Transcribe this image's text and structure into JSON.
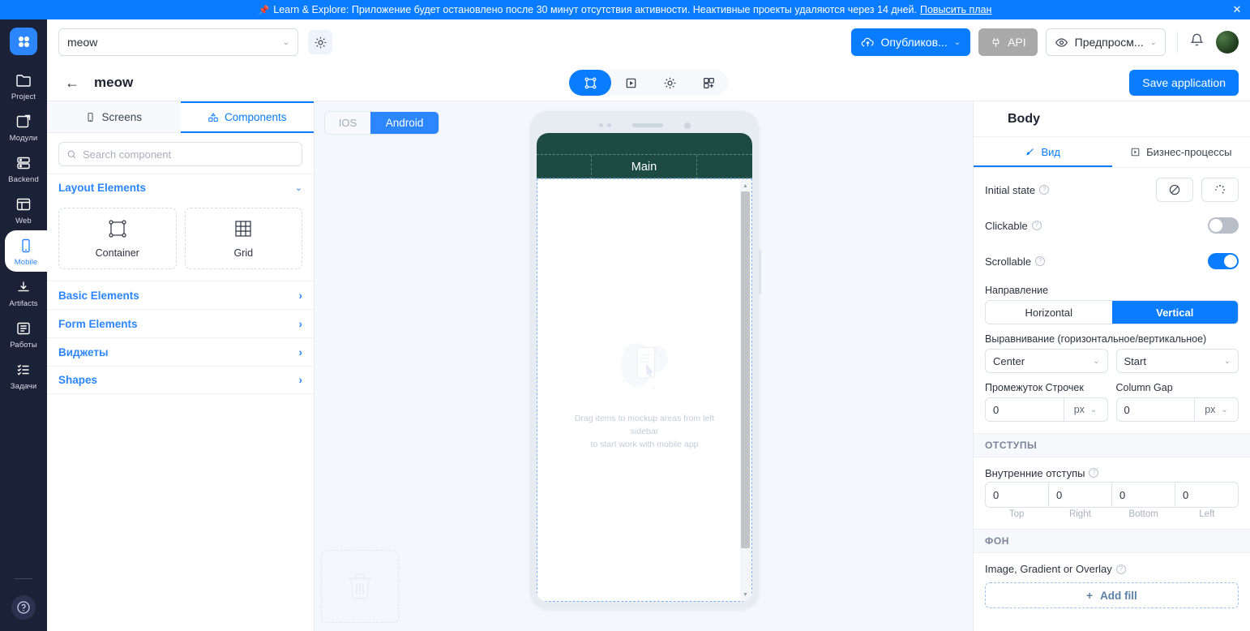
{
  "banner": {
    "icon": "pushpin-icon",
    "text": "Learn & Explore: Приложение будет остановлено после 30 минут отсутствия активности. Неактивные проекты удаляются через 14 дней.",
    "link": "Повысить план",
    "close": "✕"
  },
  "rail": {
    "logo": "grid-logo-icon",
    "items": [
      {
        "label": "Project",
        "icon": "folder-icon"
      },
      {
        "label": "Модули",
        "icon": "modules-icon"
      },
      {
        "label": "Backend",
        "icon": "server-icon"
      },
      {
        "label": "Web",
        "icon": "browser-icon"
      },
      {
        "label": "Mobile",
        "icon": "phone-icon"
      },
      {
        "label": "Artifacts",
        "icon": "download-icon"
      },
      {
        "label": "Работы",
        "icon": "list-icon"
      },
      {
        "label": "Задачи",
        "icon": "checklist-icon"
      }
    ],
    "active": "Mobile",
    "help": "?"
  },
  "header": {
    "project_name": "meow",
    "settings_icon": "gear-icon",
    "publish_label": "Опубликов...",
    "api_label": "API",
    "preview_label": "Предпросм...",
    "bell_icon": "bell-icon",
    "avatar": "user-avatar"
  },
  "subheader": {
    "back_icon": "back-arrow-icon",
    "title": "meow",
    "tools": [
      {
        "name": "design-tool",
        "icon": "frame-icon",
        "active": true
      },
      {
        "name": "preview-tool",
        "icon": "play-icon",
        "active": false
      },
      {
        "name": "settings-tool",
        "icon": "gear-icon",
        "active": false
      },
      {
        "name": "integrations-tool",
        "icon": "puzzle-icon",
        "active": false
      }
    ],
    "save_label": "Save application"
  },
  "left_panel": {
    "tabs": [
      {
        "label": "Screens",
        "icon": "phone-icon",
        "active": false
      },
      {
        "label": "Components",
        "icon": "components-icon",
        "active": true
      }
    ],
    "search_placeholder": "Search component",
    "search_value": "",
    "sections": [
      {
        "label": "Layout Elements",
        "expanded": true
      },
      {
        "label": "Basic Elements",
        "expanded": false
      },
      {
        "label": "Form Elements",
        "expanded": false
      },
      {
        "label": "Виджеты",
        "expanded": false
      },
      {
        "label": "Shapes",
        "expanded": false
      }
    ],
    "layout_components": [
      {
        "label": "Container",
        "icon": "container-icon"
      },
      {
        "label": "Grid",
        "icon": "grid-icon"
      }
    ]
  },
  "canvas": {
    "platforms": [
      {
        "label": "IOS",
        "active": false
      },
      {
        "label": "Android",
        "active": true
      }
    ],
    "phone": {
      "appbar_title": "Main",
      "appbar_color": "#1d4a42",
      "placeholder_line1": "Drag items to mockup areas from left sidebar",
      "placeholder_line2": "to start work with mobile app"
    },
    "trash_icon": "trash-icon"
  },
  "right_panel": {
    "title": "Body",
    "tabs": [
      {
        "label": "Вид",
        "icon": "brush-icon",
        "active": true
      },
      {
        "label": "Бизнес-процессы",
        "icon": "flow-icon",
        "active": false
      }
    ],
    "initial_state": {
      "label": "Initial state",
      "options": [
        {
          "name": "disabled-icon",
          "glyph": "⊘"
        },
        {
          "name": "loading-icon",
          "glyph": "◌"
        }
      ]
    },
    "clickable": {
      "label": "Clickable",
      "value": false
    },
    "scrollable": {
      "label": "Scrollable",
      "value": true
    },
    "direction": {
      "label": "Направление",
      "options": [
        "Horizontal",
        "Vertical"
      ],
      "selected": "Vertical"
    },
    "alignment": {
      "label": "Выравнивание (горизонтальное/вертикальное)",
      "horizontal": "Center",
      "vertical": "Start"
    },
    "row_gap": {
      "label": "Промежуток Строчек",
      "value": "0",
      "unit": "px"
    },
    "column_gap": {
      "label": "Column Gap",
      "value": "0",
      "unit": "px"
    },
    "paddings_group": "ОТСТУПЫ",
    "inner_paddings": {
      "label": "Внутренние отступы",
      "values": [
        "0",
        "0",
        "0",
        "0"
      ],
      "labels": [
        "Top",
        "Right",
        "Bottom",
        "Left"
      ]
    },
    "background_group": "ФОН",
    "fill": {
      "label": "Image, Gradient or Overlay",
      "add_label": "Add fill",
      "plus": "+"
    }
  },
  "colors": {
    "accent": "#0a7cff",
    "rail_bg": "#1b2238",
    "appbar": "#1d4a42",
    "canvas_bg": "#f4f7fb"
  }
}
